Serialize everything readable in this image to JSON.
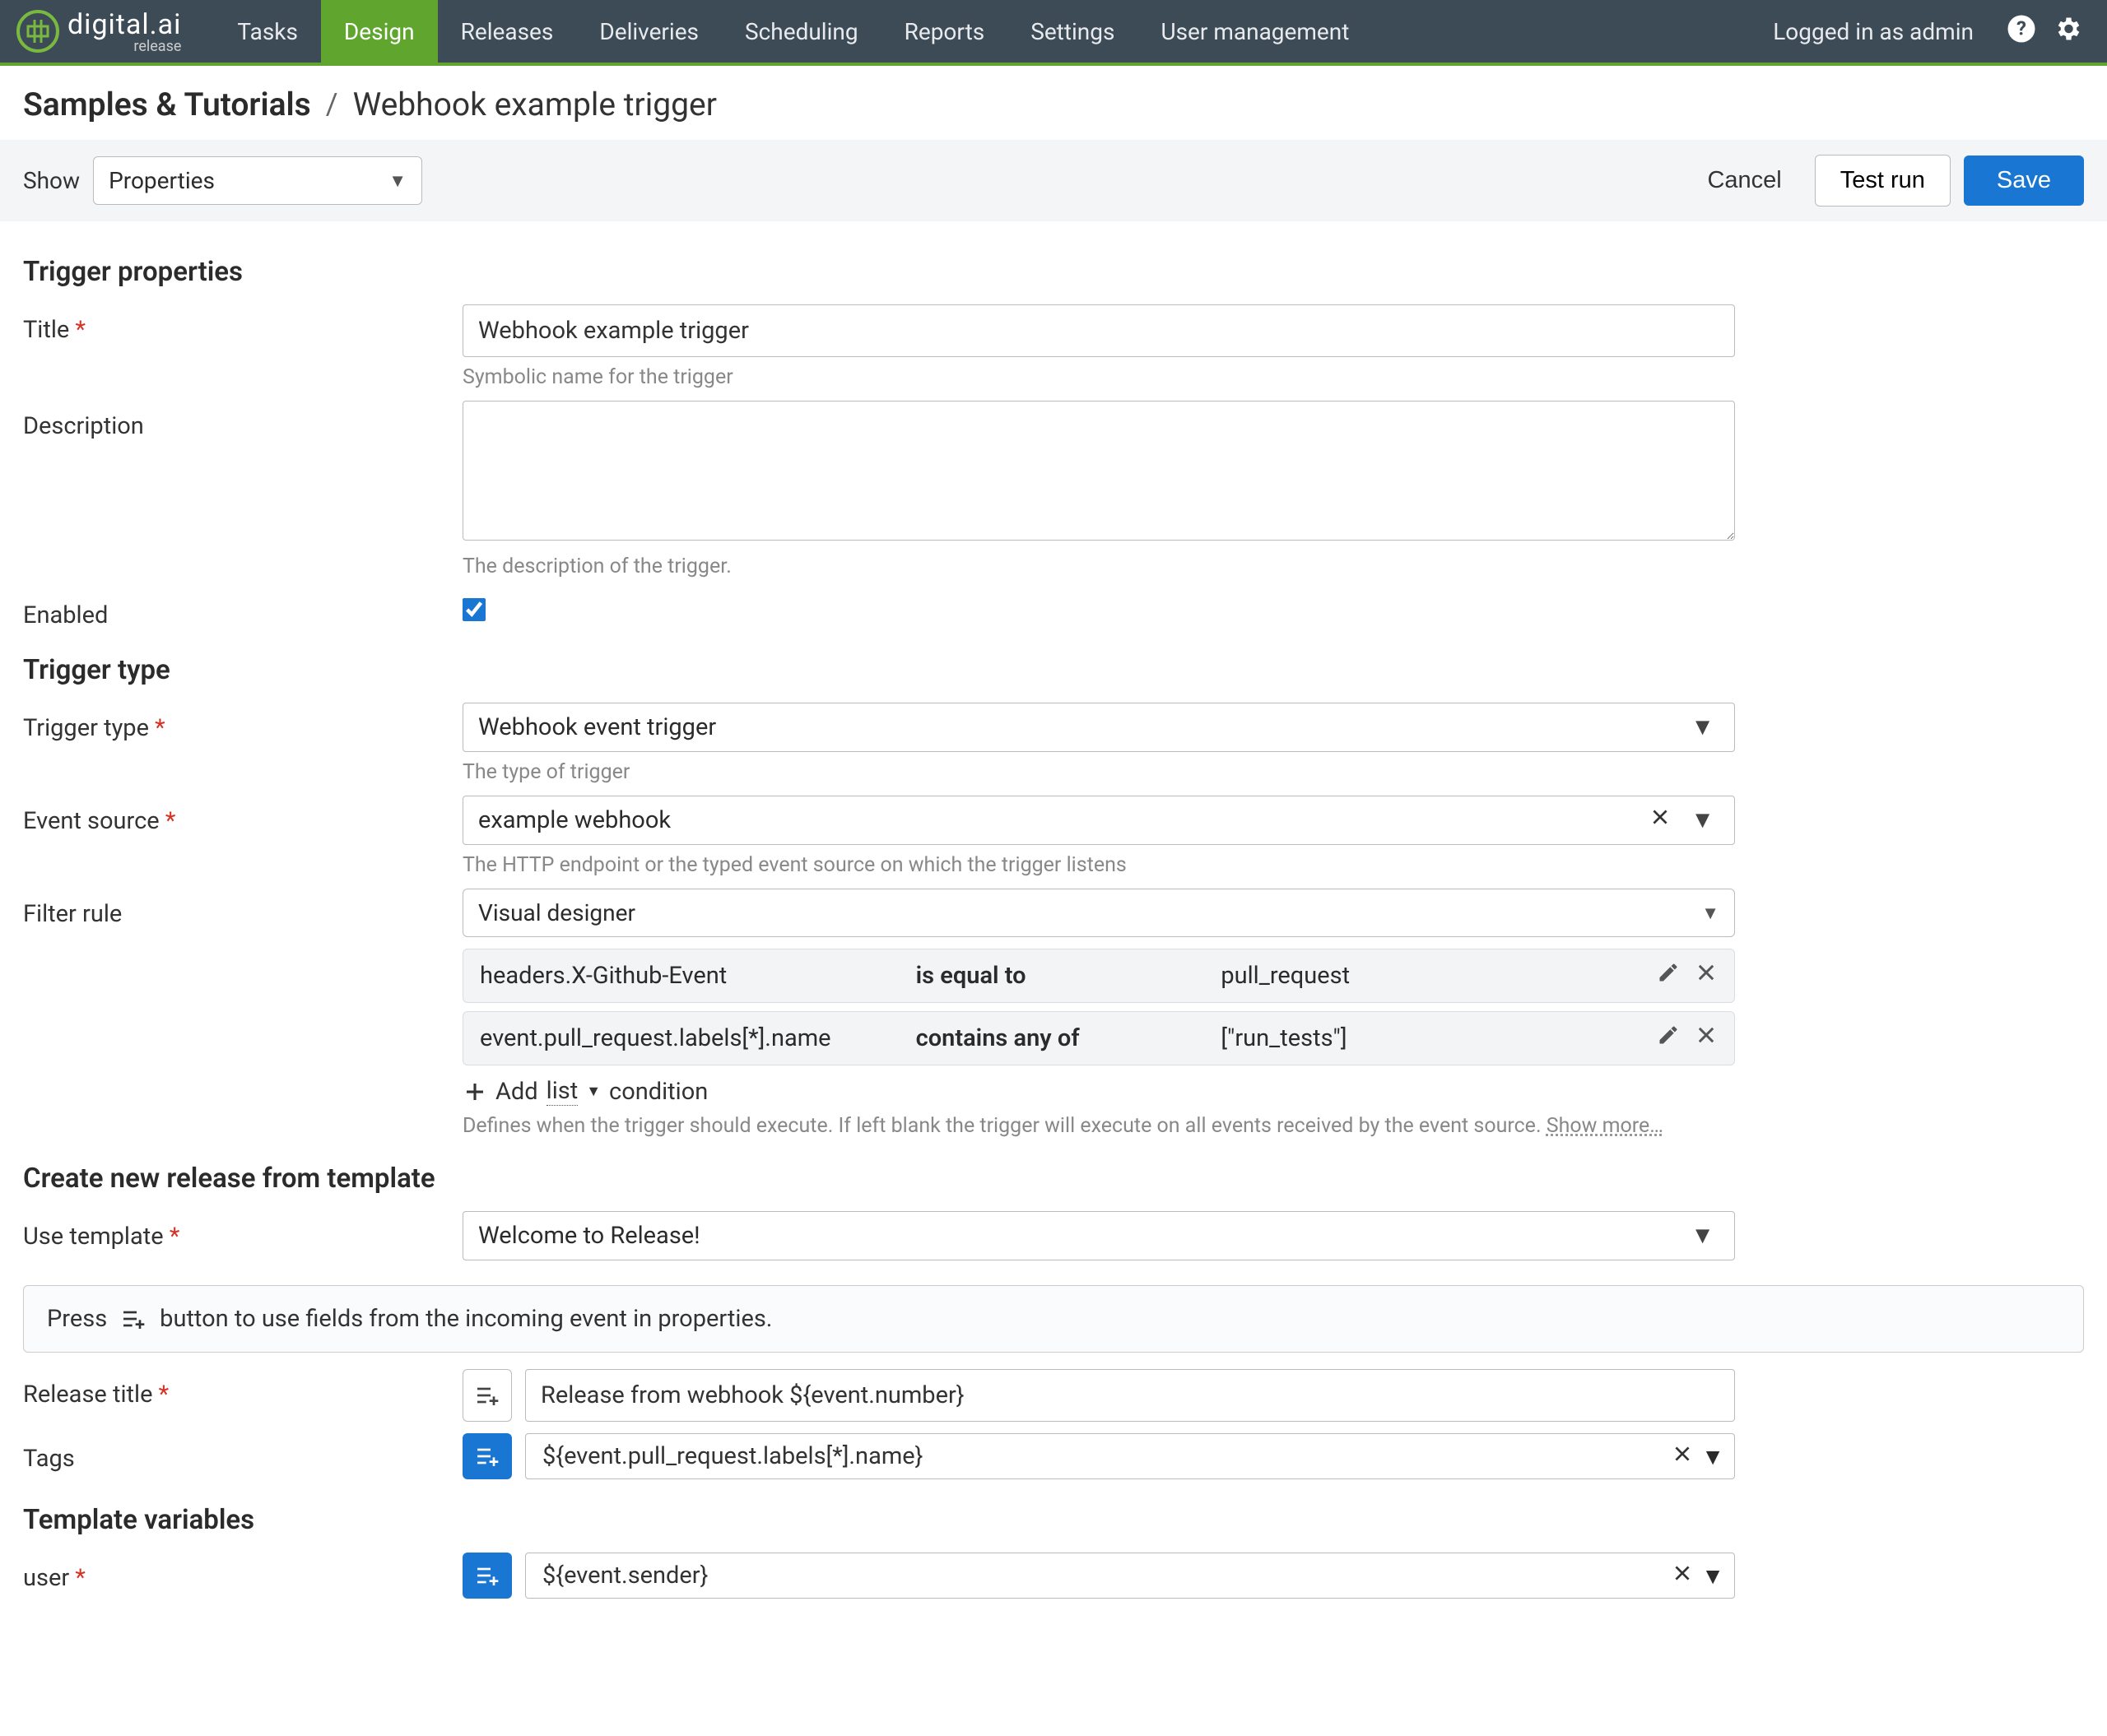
{
  "header": {
    "product_name": "digital.ai",
    "product_sub": "release",
    "nav": [
      "Tasks",
      "Design",
      "Releases",
      "Deliveries",
      "Scheduling",
      "Reports",
      "Settings",
      "User management"
    ],
    "login_text": "Logged in as admin"
  },
  "breadcrumb": {
    "folder": "Samples & Tutorials",
    "sep": "/",
    "page": "Webhook example trigger"
  },
  "toolbar": {
    "show_label": "Show",
    "show_value": "Properties",
    "cancel": "Cancel",
    "test_run": "Test run",
    "save": "Save"
  },
  "sections": {
    "props_title": "Trigger properties",
    "title_label": "Title",
    "title_value": "Webhook example trigger",
    "title_help": "Symbolic name for the trigger",
    "desc_label": "Description",
    "desc_help": "The description of the trigger.",
    "enabled_label": "Enabled",
    "type_title": "Trigger type",
    "type_label": "Trigger type",
    "type_value": "Webhook event trigger",
    "type_help": "The type of trigger",
    "source_label": "Event source",
    "source_value": "example webhook",
    "source_help": "The HTTP endpoint or the typed event source on which the trigger listens",
    "filter_label": "Filter rule",
    "filter_mode": "Visual designer",
    "rules": [
      {
        "path": "headers.X-Github-Event",
        "op": "is equal to",
        "val": "pull_request"
      },
      {
        "path": "event.pull_request.labels[*].name",
        "op": "contains any of",
        "val": "[\"run_tests\"]"
      }
    ],
    "add_cond_pre": "Add",
    "add_cond_mid": "list",
    "add_cond_post": "condition",
    "filter_help": "Defines when the trigger should execute. If left blank the trigger will execute on all events received by the event source.",
    "show_more": "Show more…",
    "create_title": "Create new release from template",
    "tpl_label": "Use template",
    "tpl_value": "Welcome to Release!",
    "info_pre": "Press",
    "info_post": "button to use fields from the incoming event in properties.",
    "rel_title_label": "Release title",
    "rel_title_value": "Release from webhook ${event.number}",
    "tags_label": "Tags",
    "tags_value": "${event.pull_request.labels[*].name}",
    "vars_title": "Template variables",
    "user_label": "user",
    "user_value": "${event.sender}"
  }
}
